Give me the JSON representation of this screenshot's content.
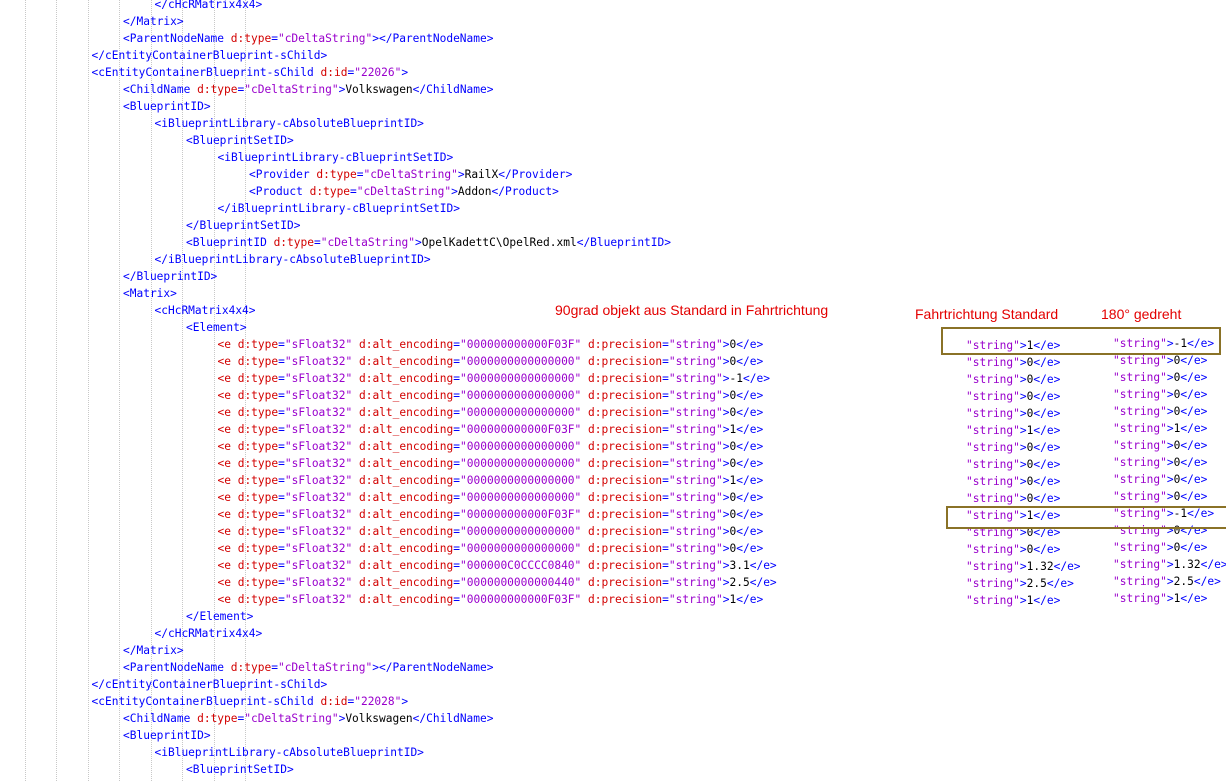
{
  "code_lines": [
    {
      "indent": 5,
      "parts": [
        [
          "b",
          "</"
        ],
        [
          "b",
          "cHcRMatrix4x4"
        ],
        [
          "b",
          ">"
        ]
      ]
    },
    {
      "indent": 4,
      "parts": [
        [
          "b",
          "</"
        ],
        [
          "b",
          "Matrix"
        ],
        [
          "b",
          ">"
        ]
      ]
    },
    {
      "indent": 4,
      "parts": [
        [
          "b",
          "<ParentNodeName "
        ],
        [
          "a",
          "d:type"
        ],
        [
          "b",
          "="
        ],
        [
          "s",
          "\"cDeltaString\""
        ],
        [
          "b",
          "></ParentNodeName>"
        ]
      ]
    },
    {
      "indent": 3,
      "parts": [
        [
          "b",
          "</cEntityContainerBlueprint-sChild>"
        ]
      ]
    },
    {
      "indent": 3,
      "parts": [
        [
          "b",
          "<cEntityContainerBlueprint-sChild "
        ],
        [
          "a",
          "d:id"
        ],
        [
          "b",
          "="
        ],
        [
          "s",
          "\"22026\""
        ],
        [
          "b",
          ">"
        ]
      ]
    },
    {
      "indent": 4,
      "parts": [
        [
          "b",
          "<ChildName "
        ],
        [
          "a",
          "d:type"
        ],
        [
          "b",
          "="
        ],
        [
          "s",
          "\"cDeltaString\""
        ],
        [
          "b",
          ">"
        ],
        [
          "t",
          "Volkswagen"
        ],
        [
          "b",
          "</ChildName>"
        ]
      ]
    },
    {
      "indent": 4,
      "parts": [
        [
          "b",
          "<BlueprintID>"
        ]
      ]
    },
    {
      "indent": 5,
      "parts": [
        [
          "b",
          "<iBlueprintLibrary-cAbsoluteBlueprintID>"
        ]
      ]
    },
    {
      "indent": 6,
      "parts": [
        [
          "b",
          "<BlueprintSetID>"
        ]
      ]
    },
    {
      "indent": 7,
      "parts": [
        [
          "b",
          "<iBlueprintLibrary-cBlueprintSetID>"
        ]
      ]
    },
    {
      "indent": 8,
      "parts": [
        [
          "b",
          "<Provider "
        ],
        [
          "a",
          "d:type"
        ],
        [
          "b",
          "="
        ],
        [
          "s",
          "\"cDeltaString\""
        ],
        [
          "b",
          ">"
        ],
        [
          "t",
          "RailX"
        ],
        [
          "b",
          "</Provider>"
        ]
      ]
    },
    {
      "indent": 8,
      "parts": [
        [
          "b",
          "<Product "
        ],
        [
          "a",
          "d:type"
        ],
        [
          "b",
          "="
        ],
        [
          "s",
          "\"cDeltaString\""
        ],
        [
          "b",
          ">"
        ],
        [
          "t",
          "Addon"
        ],
        [
          "b",
          "</Product>"
        ]
      ]
    },
    {
      "indent": 7,
      "parts": [
        [
          "b",
          "</iBlueprintLibrary-cBlueprintSetID>"
        ]
      ]
    },
    {
      "indent": 6,
      "parts": [
        [
          "b",
          "</BlueprintSetID>"
        ]
      ]
    },
    {
      "indent": 6,
      "parts": [
        [
          "b",
          "<BlueprintID "
        ],
        [
          "a",
          "d:type"
        ],
        [
          "b",
          "="
        ],
        [
          "s",
          "\"cDeltaString\""
        ],
        [
          "b",
          ">"
        ],
        [
          "t",
          "OpelKadettC\\OpelRed.xml"
        ],
        [
          "b",
          "</BlueprintID>"
        ]
      ]
    },
    {
      "indent": 5,
      "parts": [
        [
          "b",
          "</iBlueprintLibrary-cAbsoluteBlueprintID>"
        ]
      ]
    },
    {
      "indent": 4,
      "parts": [
        [
          "b",
          "</BlueprintID>"
        ]
      ]
    },
    {
      "indent": 4,
      "parts": [
        [
          "b",
          "<Matrix>"
        ]
      ]
    },
    {
      "indent": 5,
      "parts": [
        [
          "b",
          "<cHcRMatrix4x4>"
        ]
      ]
    },
    {
      "indent": 6,
      "parts": [
        [
          "b",
          "<Element>"
        ]
      ]
    },
    {
      "indent": 7,
      "parts": [
        [
          "a",
          "<e d:type"
        ],
        [
          "b",
          "="
        ],
        [
          "s",
          "\"sFloat32\""
        ],
        [
          "a",
          " d:alt_encoding"
        ],
        [
          "b",
          "="
        ],
        [
          "s",
          "\"000000000000F03F\""
        ],
        [
          "a",
          " d:precision"
        ],
        [
          "b",
          "="
        ],
        [
          "s",
          "\"string\""
        ],
        [
          "b",
          ">"
        ],
        [
          "t",
          "0"
        ],
        [
          "b",
          "</e>"
        ]
      ]
    },
    {
      "indent": 7,
      "parts": [
        [
          "a",
          "<e d:type"
        ],
        [
          "b",
          "="
        ],
        [
          "s",
          "\"sFloat32\""
        ],
        [
          "a",
          " d:alt_encoding"
        ],
        [
          "b",
          "="
        ],
        [
          "s",
          "\"0000000000000000\""
        ],
        [
          "a",
          " d:precision"
        ],
        [
          "b",
          "="
        ],
        [
          "s",
          "\"string\""
        ],
        [
          "b",
          ">"
        ],
        [
          "t",
          "0"
        ],
        [
          "b",
          "</e>"
        ]
      ]
    },
    {
      "indent": 7,
      "parts": [
        [
          "a",
          "<e d:type"
        ],
        [
          "b",
          "="
        ],
        [
          "s",
          "\"sFloat32\""
        ],
        [
          "a",
          " d:alt_encoding"
        ],
        [
          "b",
          "="
        ],
        [
          "s",
          "\"0000000000000000\""
        ],
        [
          "a",
          " d:precision"
        ],
        [
          "b",
          "="
        ],
        [
          "s",
          "\"string\""
        ],
        [
          "b",
          ">"
        ],
        [
          "t",
          "-1"
        ],
        [
          "b",
          "</e>"
        ]
      ]
    },
    {
      "indent": 7,
      "parts": [
        [
          "a",
          "<e d:type"
        ],
        [
          "b",
          "="
        ],
        [
          "s",
          "\"sFloat32\""
        ],
        [
          "a",
          " d:alt_encoding"
        ],
        [
          "b",
          "="
        ],
        [
          "s",
          "\"0000000000000000\""
        ],
        [
          "a",
          " d:precision"
        ],
        [
          "b",
          "="
        ],
        [
          "s",
          "\"string\""
        ],
        [
          "b",
          ">"
        ],
        [
          "t",
          "0"
        ],
        [
          "b",
          "</e>"
        ]
      ]
    },
    {
      "indent": 7,
      "parts": [
        [
          "a",
          "<e d:type"
        ],
        [
          "b",
          "="
        ],
        [
          "s",
          "\"sFloat32\""
        ],
        [
          "a",
          " d:alt_encoding"
        ],
        [
          "b",
          "="
        ],
        [
          "s",
          "\"0000000000000000\""
        ],
        [
          "a",
          " d:precision"
        ],
        [
          "b",
          "="
        ],
        [
          "s",
          "\"string\""
        ],
        [
          "b",
          ">"
        ],
        [
          "t",
          "0"
        ],
        [
          "b",
          "</e>"
        ]
      ]
    },
    {
      "indent": 7,
      "parts": [
        [
          "a",
          "<e d:type"
        ],
        [
          "b",
          "="
        ],
        [
          "s",
          "\"sFloat32\""
        ],
        [
          "a",
          " d:alt_encoding"
        ],
        [
          "b",
          "="
        ],
        [
          "s",
          "\"000000000000F03F\""
        ],
        [
          "a",
          " d:precision"
        ],
        [
          "b",
          "="
        ],
        [
          "s",
          "\"string\""
        ],
        [
          "b",
          ">"
        ],
        [
          "t",
          "1"
        ],
        [
          "b",
          "</e>"
        ]
      ]
    },
    {
      "indent": 7,
      "parts": [
        [
          "a",
          "<e d:type"
        ],
        [
          "b",
          "="
        ],
        [
          "s",
          "\"sFloat32\""
        ],
        [
          "a",
          " d:alt_encoding"
        ],
        [
          "b",
          "="
        ],
        [
          "s",
          "\"0000000000000000\""
        ],
        [
          "a",
          " d:precision"
        ],
        [
          "b",
          "="
        ],
        [
          "s",
          "\"string\""
        ],
        [
          "b",
          ">"
        ],
        [
          "t",
          "0"
        ],
        [
          "b",
          "</e>"
        ]
      ]
    },
    {
      "indent": 7,
      "parts": [
        [
          "a",
          "<e d:type"
        ],
        [
          "b",
          "="
        ],
        [
          "s",
          "\"sFloat32\""
        ],
        [
          "a",
          " d:alt_encoding"
        ],
        [
          "b",
          "="
        ],
        [
          "s",
          "\"0000000000000000\""
        ],
        [
          "a",
          " d:precision"
        ],
        [
          "b",
          "="
        ],
        [
          "s",
          "\"string\""
        ],
        [
          "b",
          ">"
        ],
        [
          "t",
          "0"
        ],
        [
          "b",
          "</e>"
        ]
      ]
    },
    {
      "indent": 7,
      "parts": [
        [
          "a",
          "<e d:type"
        ],
        [
          "b",
          "="
        ],
        [
          "s",
          "\"sFloat32\""
        ],
        [
          "a",
          " d:alt_encoding"
        ],
        [
          "b",
          "="
        ],
        [
          "s",
          "\"0000000000000000\""
        ],
        [
          "a",
          " d:precision"
        ],
        [
          "b",
          "="
        ],
        [
          "s",
          "\"string\""
        ],
        [
          "b",
          ">"
        ],
        [
          "t",
          "1"
        ],
        [
          "b",
          "</e>"
        ]
      ]
    },
    {
      "indent": 7,
      "parts": [
        [
          "a",
          "<e d:type"
        ],
        [
          "b",
          "="
        ],
        [
          "s",
          "\"sFloat32\""
        ],
        [
          "a",
          " d:alt_encoding"
        ],
        [
          "b",
          "="
        ],
        [
          "s",
          "\"0000000000000000\""
        ],
        [
          "a",
          " d:precision"
        ],
        [
          "b",
          "="
        ],
        [
          "s",
          "\"string\""
        ],
        [
          "b",
          ">"
        ],
        [
          "t",
          "0"
        ],
        [
          "b",
          "</e>"
        ]
      ]
    },
    {
      "indent": 7,
      "parts": [
        [
          "a",
          "<e d:type"
        ],
        [
          "b",
          "="
        ],
        [
          "s",
          "\"sFloat32\""
        ],
        [
          "a",
          " d:alt_encoding"
        ],
        [
          "b",
          "="
        ],
        [
          "s",
          "\"000000000000F03F\""
        ],
        [
          "a",
          " d:precision"
        ],
        [
          "b",
          "="
        ],
        [
          "s",
          "\"string\""
        ],
        [
          "b",
          ">"
        ],
        [
          "t",
          "0"
        ],
        [
          "b",
          "</e>"
        ]
      ]
    },
    {
      "indent": 7,
      "parts": [
        [
          "a",
          "<e d:type"
        ],
        [
          "b",
          "="
        ],
        [
          "s",
          "\"sFloat32\""
        ],
        [
          "a",
          " d:alt_encoding"
        ],
        [
          "b",
          "="
        ],
        [
          "s",
          "\"0000000000000000\""
        ],
        [
          "a",
          " d:precision"
        ],
        [
          "b",
          "="
        ],
        [
          "s",
          "\"string\""
        ],
        [
          "b",
          ">"
        ],
        [
          "t",
          "0"
        ],
        [
          "b",
          "</e>"
        ]
      ]
    },
    {
      "indent": 7,
      "parts": [
        [
          "a",
          "<e d:type"
        ],
        [
          "b",
          "="
        ],
        [
          "s",
          "\"sFloat32\""
        ],
        [
          "a",
          " d:alt_encoding"
        ],
        [
          "b",
          "="
        ],
        [
          "s",
          "\"0000000000000000\""
        ],
        [
          "a",
          " d:precision"
        ],
        [
          "b",
          "="
        ],
        [
          "s",
          "\"string\""
        ],
        [
          "b",
          ">"
        ],
        [
          "t",
          "0"
        ],
        [
          "b",
          "</e>"
        ]
      ]
    },
    {
      "indent": 7,
      "parts": [
        [
          "a",
          "<e d:type"
        ],
        [
          "b",
          "="
        ],
        [
          "s",
          "\"sFloat32\""
        ],
        [
          "a",
          " d:alt_encoding"
        ],
        [
          "b",
          "="
        ],
        [
          "s",
          "\"000000C0CCCC0840\""
        ],
        [
          "a",
          " d:precision"
        ],
        [
          "b",
          "="
        ],
        [
          "s",
          "\"string\""
        ],
        [
          "b",
          ">"
        ],
        [
          "t",
          "3.1"
        ],
        [
          "b",
          "</e>"
        ]
      ]
    },
    {
      "indent": 7,
      "parts": [
        [
          "a",
          "<e d:type"
        ],
        [
          "b",
          "="
        ],
        [
          "s",
          "\"sFloat32\""
        ],
        [
          "a",
          " d:alt_encoding"
        ],
        [
          "b",
          "="
        ],
        [
          "s",
          "\"0000000000000440\""
        ],
        [
          "a",
          " d:precision"
        ],
        [
          "b",
          "="
        ],
        [
          "s",
          "\"string\""
        ],
        [
          "b",
          ">"
        ],
        [
          "t",
          "2.5"
        ],
        [
          "b",
          "</e>"
        ]
      ]
    },
    {
      "indent": 7,
      "parts": [
        [
          "a",
          "<e d:type"
        ],
        [
          "b",
          "="
        ],
        [
          "s",
          "\"sFloat32\""
        ],
        [
          "a",
          " d:alt_encoding"
        ],
        [
          "b",
          "="
        ],
        [
          "s",
          "\"000000000000F03F\""
        ],
        [
          "a",
          " d:precision"
        ],
        [
          "b",
          "="
        ],
        [
          "s",
          "\"string\""
        ],
        [
          "b",
          ">"
        ],
        [
          "t",
          "1"
        ],
        [
          "b",
          "</e>"
        ]
      ]
    },
    {
      "indent": 6,
      "parts": [
        [
          "b",
          "</Element>"
        ]
      ]
    },
    {
      "indent": 5,
      "parts": [
        [
          "b",
          "</cHcRMatrix4x4>"
        ]
      ]
    },
    {
      "indent": 4,
      "parts": [
        [
          "b",
          "</Matrix>"
        ]
      ]
    },
    {
      "indent": 4,
      "parts": [
        [
          "b",
          "<ParentNodeName "
        ],
        [
          "a",
          "d:type"
        ],
        [
          "b",
          "="
        ],
        [
          "s",
          "\"cDeltaString\""
        ],
        [
          "b",
          "></ParentNodeName>"
        ]
      ]
    },
    {
      "indent": 3,
      "parts": [
        [
          "b",
          "</cEntityContainerBlueprint-sChild>"
        ]
      ]
    },
    {
      "indent": 3,
      "parts": [
        [
          "b",
          "<cEntityContainerBlueprint-sChild "
        ],
        [
          "a",
          "d:id"
        ],
        [
          "b",
          "="
        ],
        [
          "s",
          "\"22028\""
        ],
        [
          "b",
          ">"
        ]
      ]
    },
    {
      "indent": 4,
      "parts": [
        [
          "b",
          "<ChildName "
        ],
        [
          "a",
          "d:type"
        ],
        [
          "b",
          "="
        ],
        [
          "s",
          "\"cDeltaString\""
        ],
        [
          "b",
          ">"
        ],
        [
          "t",
          "Volkswagen"
        ],
        [
          "b",
          "</ChildName>"
        ]
      ]
    },
    {
      "indent": 4,
      "parts": [
        [
          "b",
          "<BlueprintID>"
        ]
      ]
    },
    {
      "indent": 5,
      "parts": [
        [
          "b",
          "<iBlueprintLibrary-cAbsoluteBlueprintID>"
        ]
      ]
    },
    {
      "indent": 6,
      "parts": [
        [
          "b",
          "<BlueprintSetID>"
        ]
      ]
    }
  ],
  "annotations": {
    "note_90": "90grad objekt aus Standard in Fahrtrichtung",
    "label_standard": "Fahrtrichtung Standard",
    "label_180": "180° gedreht"
  },
  "column_standard": [
    "1",
    "0",
    "0",
    "0",
    "0",
    "1",
    "0",
    "0",
    "0",
    "0",
    "1",
    "0",
    "0",
    "1.32",
    "2.5",
    "1"
  ],
  "column_180": [
    "-1",
    "0",
    "0",
    "0",
    "0",
    "1",
    "0",
    "0",
    "0",
    "0",
    "-1",
    "0",
    "0",
    "1.32",
    "2.5",
    "1"
  ]
}
